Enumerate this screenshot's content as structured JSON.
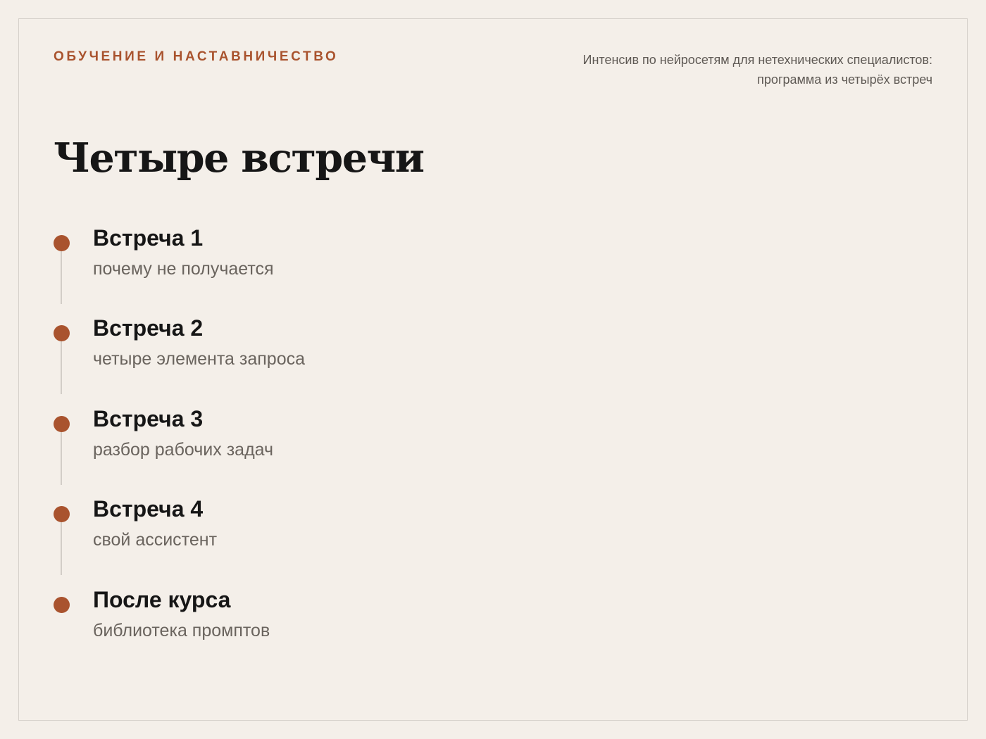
{
  "header": {
    "eyebrow": "ОБУЧЕНИЕ И НАСТАВНИЧЕСТВО",
    "subtitle_line1": "Интенсив по нейросетям для нетехнических специалистов:",
    "subtitle_line2": "программа из четырёх встреч"
  },
  "title": "Четыре встречи",
  "timeline": {
    "items": [
      {
        "title": "Встреча 1",
        "description": "почему не получается"
      },
      {
        "title": "Встреча 2",
        "description": "четыре элемента запроса"
      },
      {
        "title": "Встреча 3",
        "description": "разбор рабочих задач"
      },
      {
        "title": "Встреча 4",
        "description": "свой ассистент"
      },
      {
        "title": "После курса",
        "description": "библиотека промптов"
      }
    ]
  },
  "colors": {
    "accent": "#a9532e",
    "background": "#f4efe9",
    "text": "#161616",
    "muted": "#6a645e",
    "rule": "#d2cdc7"
  }
}
